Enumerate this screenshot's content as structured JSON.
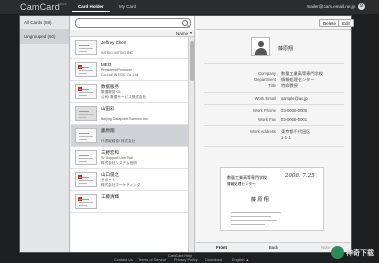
{
  "app": {
    "logo": "CamCard",
    "logo_sup": "Web",
    "tabs": [
      {
        "label": "Card Holder",
        "active": true
      },
      {
        "label": "My Card",
        "active": false
      }
    ],
    "account": "mailer@cam.email.ne.jp",
    "settings_icon": "gear-icon"
  },
  "groups": [
    {
      "label": "All Cards (59)",
      "selected": false
    },
    {
      "label": "Ungrouped (50)",
      "selected": true
    }
  ],
  "list": {
    "search_placeholder": "",
    "sort_label": "Name",
    "cards": [
      {
        "name": "Jeffrey Chen",
        "line1": "",
        "line2": "INTSIG INTSIG INC"
      },
      {
        "name": "MEO",
        "line1": "President/Producer",
        "line2": "Co.Ltd/ INTSIG Co.,Ltd"
      },
      {
        "name": "数据服务",
        "line1": "数据服务 GL",
        "line2": "公司/ 数据サービス株式会社"
      },
      {
        "name": "山田彩",
        "line1": "",
        "line2": "Beijing Datapoint Science Inc."
      },
      {
        "name": "藤原翔",
        "line1": "",
        "line2": "代表取締役/ 株式会社"
      },
      {
        "name": "三野宏和",
        "line1": "Sr Support Unit Tool",
        "line2": "株式会社システム技研"
      },
      {
        "name": "山口俊之",
        "line1": "サポート",
        "line2": "株式会社マーケティング"
      },
      {
        "name": "工藤清輝",
        "line1": "",
        "line2": ""
      }
    ],
    "selected_index": 4
  },
  "detail": {
    "buttons": {
      "delete": "Delete",
      "edit": "Edit"
    },
    "name": "藤原翔",
    "fields": [
      {
        "label": "Company",
        "value": "数量工業高等専門学校"
      },
      {
        "label": "Department",
        "value": "情報処理センター"
      },
      {
        "label": "Title",
        "value": "特命教授"
      },
      {
        "label": "Work Email",
        "value": "sample@ac.jp"
      },
      {
        "label": "Work Phone",
        "value": "03-0000-0000"
      },
      {
        "label": "Work Fax",
        "value": "03-0000-0001"
      },
      {
        "label": "Work Address",
        "value": "東京都千代田区"
      }
    ],
    "address_extra": "1-1-1",
    "card_image": {
      "header": "数量工業高等専門学校",
      "dept": "情報処理センター",
      "handwriting": "2008. 7.25",
      "person": "藤 原 翔"
    },
    "bottom_tabs": [
      {
        "label": "Front",
        "state": "active"
      },
      {
        "label": "Back",
        "state": "normal"
      },
      {
        "label": "Note",
        "state": "dim"
      }
    ]
  },
  "footer": {
    "help": "CamCard Help",
    "links": [
      "Contact Us",
      "Terms of Service",
      "Privacy Policy",
      "Download",
      "English ▲"
    ]
  },
  "watermark": {
    "text": "神奇下载"
  }
}
